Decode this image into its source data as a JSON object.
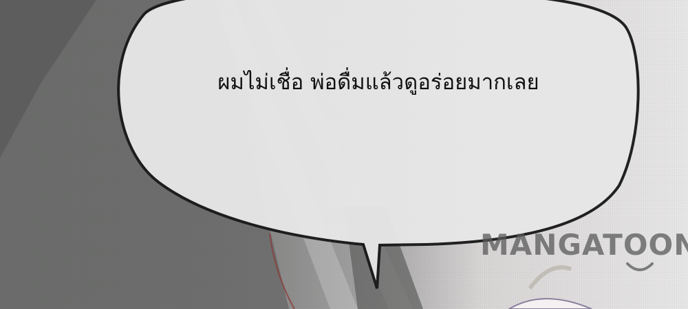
{
  "speech_bubble": {
    "text": "ผมไม่เชื่อ พ่อดื่มแล้วดูอร่อยมากเลย"
  },
  "watermark": {
    "text": "MANGATOON",
    "color": "#5a5a5a",
    "icon": "smile-icon"
  },
  "colors": {
    "bubble_fill": "#e8e7e7",
    "bubble_outline": "#1a1a1a",
    "background_left": "#6e6f6e",
    "background_right": "#ecebeb"
  }
}
